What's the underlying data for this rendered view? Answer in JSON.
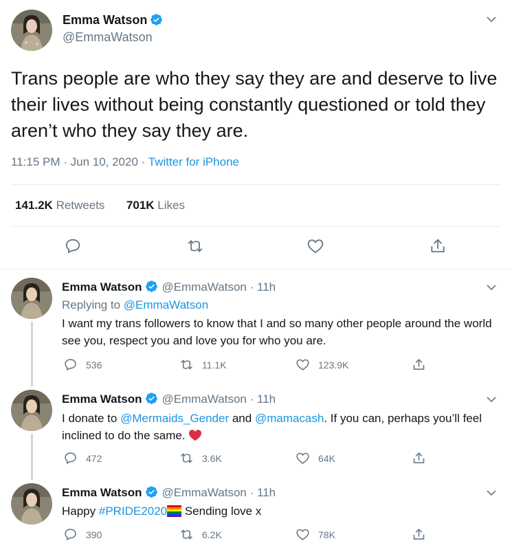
{
  "colors": {
    "link": "#1b95e0",
    "secondary": "#657786",
    "divider": "#e6ecf0",
    "verified": "#1da1f2",
    "heart": "#e0245e"
  },
  "main": {
    "name": "Emma Watson",
    "handle": "@EmmaWatson",
    "text": "Trans people are who they say they are and deserve to live their lives without being constantly questioned or told they aren’t who they say they are.",
    "time": "11:15 PM · Jun 10, 2020 · ",
    "source": "Twitter for iPhone",
    "retweets_count": "141.2K",
    "retweets_label": "Retweets",
    "likes_count": "701K",
    "likes_label": "Likes"
  },
  "replies": [
    {
      "name": "Emma Watson",
      "handle": "@EmmaWatson · 11h",
      "replying_prefix": "Replying to ",
      "replying_to": "@EmmaWatson",
      "text": "I want my trans followers to know that I and so many other people around the world see you, respect you and love you for who you are.",
      "reply_count": "536",
      "retweet_count": "11.1K",
      "like_count": "123.9K"
    },
    {
      "name": "Emma Watson",
      "handle": "@EmmaWatson · 11h",
      "text_part1": "I donate to ",
      "mention1": "@Mermaids_Gender",
      "text_part2": " and ",
      "mention2": "@mamacash",
      "text_part3": ". If you can, perhaps you’ll feel inclined to do the same. ",
      "reply_count": "472",
      "retweet_count": "3.6K",
      "like_count": "64K"
    },
    {
      "name": "Emma Watson",
      "handle": "@EmmaWatson · 11h",
      "text_part1": "Happy ",
      "hashtag": "#PRIDE2020",
      "text_part2": " Sending love x",
      "reply_count": "390",
      "retweet_count": "6.2K",
      "like_count": "78K"
    }
  ]
}
